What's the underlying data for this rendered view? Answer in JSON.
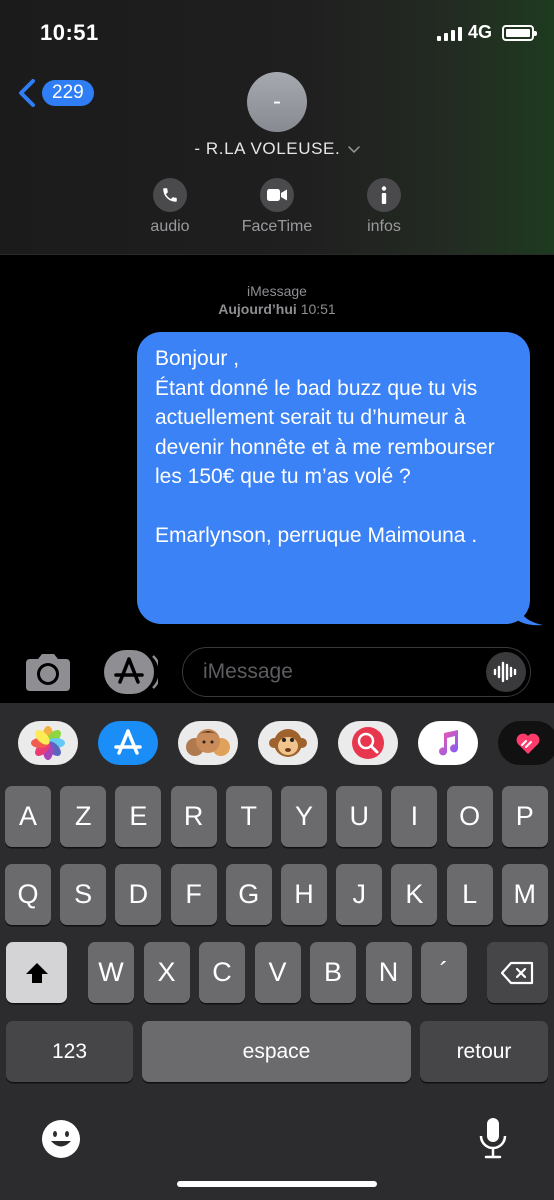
{
  "status_bar": {
    "time": "10:51",
    "network": "4G"
  },
  "header": {
    "back_count": "229",
    "avatar_initial": "-",
    "contact_name": "- R.LA VOLEUSE.",
    "actions": [
      {
        "label": "audio",
        "icon": "phone-icon"
      },
      {
        "label": "FaceTime",
        "icon": "video-camera-icon"
      },
      {
        "label": "infos",
        "icon": "info-icon"
      }
    ]
  },
  "conversation": {
    "service": "iMessage",
    "date_label": "Aujourd’hui",
    "time_label": "10:51",
    "messages": [
      {
        "from": "me",
        "text": "Bonjour ,\nÉtant donné le bad buzz que tu vis actuellement serait tu d’humeur à devenir honnête et à me rembourser les 150€ que tu m’as volé ?\n\nEmarlynson, perruque Maimouna ."
      }
    ]
  },
  "input_bar": {
    "placeholder": "iMessage"
  },
  "app_drawer": [
    {
      "name": "photos-app-icon"
    },
    {
      "name": "app-store-icon"
    },
    {
      "name": "memoji-icon"
    },
    {
      "name": "animoji-monkey-icon"
    },
    {
      "name": "web-search-icon"
    },
    {
      "name": "music-icon"
    },
    {
      "name": "digital-touch-icon"
    }
  ],
  "keyboard": {
    "row1": [
      "A",
      "Z",
      "E",
      "R",
      "T",
      "Y",
      "U",
      "I",
      "O",
      "P"
    ],
    "row2": [
      "Q",
      "S",
      "D",
      "F",
      "G",
      "H",
      "J",
      "K",
      "L",
      "M"
    ],
    "row3": [
      "W",
      "X",
      "C",
      "V",
      "B",
      "N",
      "´"
    ],
    "numbers_label": "123",
    "space_label": "espace",
    "return_label": "retour"
  },
  "colors": {
    "bubble": "#3b82f6",
    "badge": "#2f7ef6",
    "key": "#6b6b6e",
    "key_dark": "#464648"
  }
}
